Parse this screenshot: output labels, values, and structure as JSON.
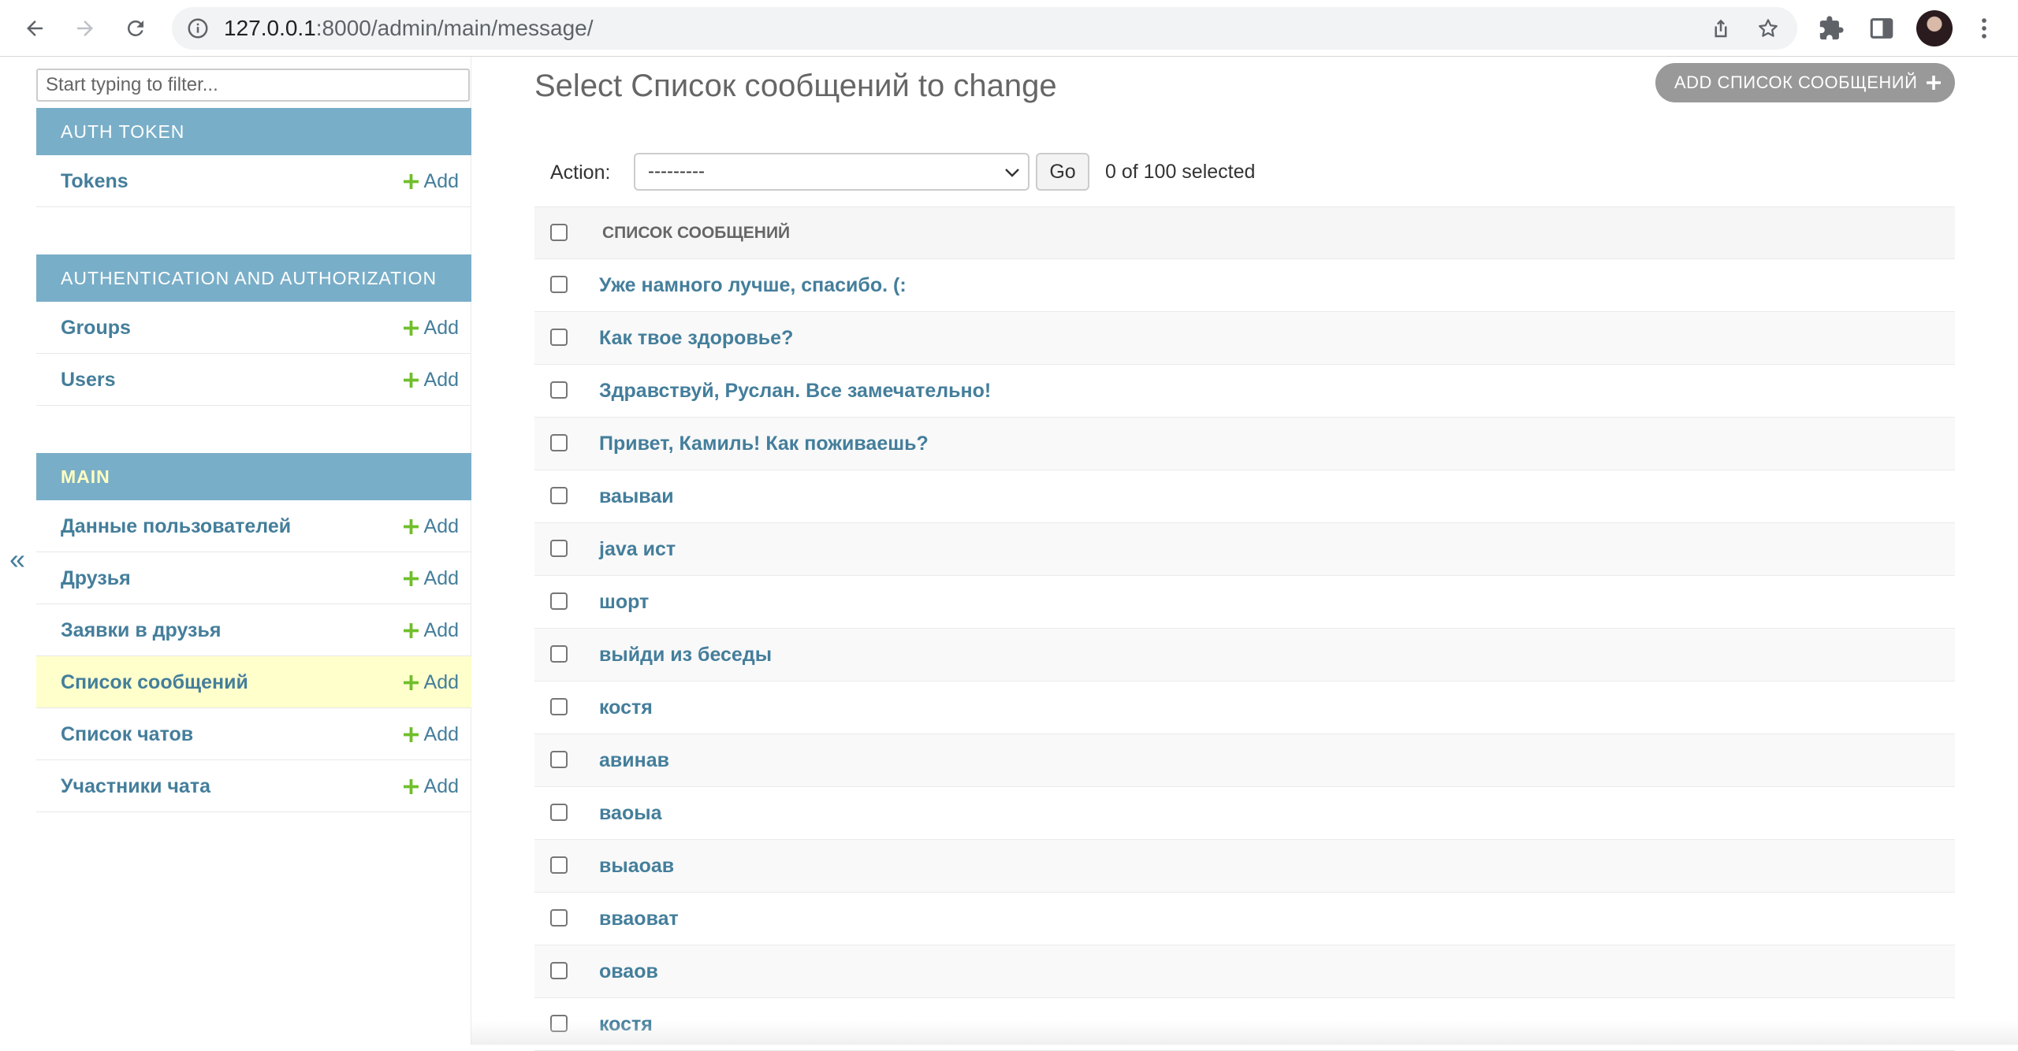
{
  "browser": {
    "url_host": "127.0.0.1",
    "url_path": ":8000/admin/main/message/"
  },
  "sidebar": {
    "filter_placeholder": "Start typing to filter...",
    "collapse_label": "«",
    "modules": [
      {
        "caption": "Auth Token",
        "items": [
          {
            "label": "Tokens",
            "add": "Add"
          }
        ]
      },
      {
        "caption": "Authentication and Authorization",
        "items": [
          {
            "label": "Groups",
            "add": "Add"
          },
          {
            "label": "Users",
            "add": "Add"
          }
        ]
      },
      {
        "caption": "Main",
        "items": [
          {
            "label": "Данные пользователей",
            "add": "Add"
          },
          {
            "label": "Друзья",
            "add": "Add"
          },
          {
            "label": "Заявки в друзья",
            "add": "Add"
          },
          {
            "label": "Список сообщений",
            "add": "Add",
            "current": true
          },
          {
            "label": "Список чатов",
            "add": "Add"
          },
          {
            "label": "Участники чата",
            "add": "Add"
          }
        ]
      }
    ]
  },
  "content": {
    "title": "Select Список сообщений to change",
    "add_button": "Add Список сообщений",
    "actions": {
      "label": "Action:",
      "selected_option": "---------",
      "go": "Go",
      "counter": "0 of 100 selected"
    },
    "table": {
      "column_header": "Список сообщений",
      "rows": [
        "Уже намного лучше, спасибо. (:",
        "Как твое здоровье?",
        "Здравствуй, Руслан. Все замечательно!",
        "Привет, Камиль! Как поживаешь?",
        "ваываи",
        "java ист",
        "шорт",
        "выйди из беседы",
        "костя",
        "авинав",
        "ваоыа",
        "выаоав",
        "вваоват",
        "оваов",
        "костя"
      ]
    }
  },
  "colors": {
    "link": "#447e9b",
    "module_header_bg": "#79aec8",
    "current_row_bg": "#ffffcc",
    "add_plus": "#70bf2b"
  }
}
